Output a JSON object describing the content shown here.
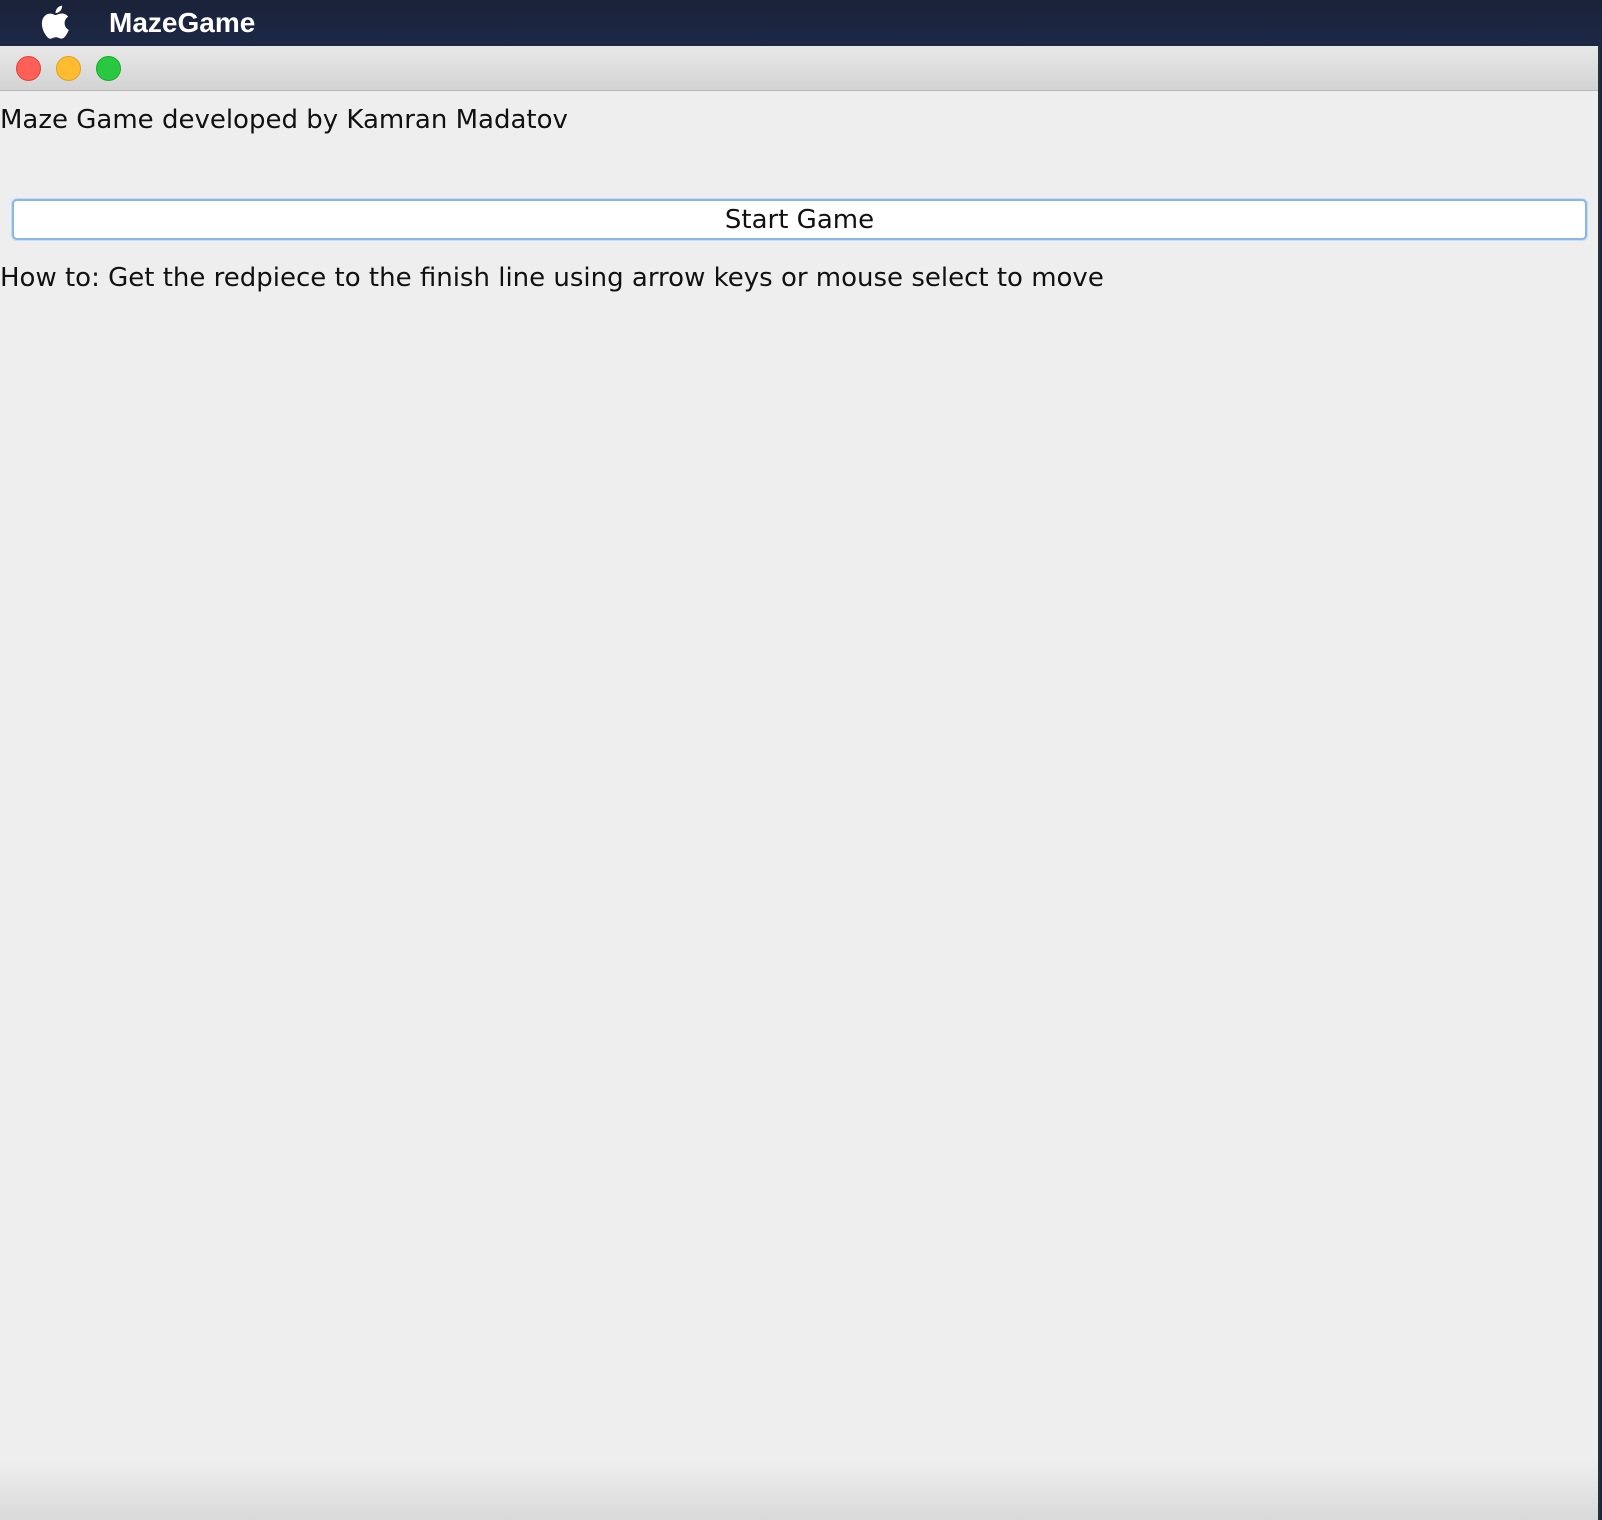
{
  "menubar": {
    "icon": "apple-icon",
    "app_name": "MazeGame"
  },
  "window": {
    "controls": [
      "close",
      "minimize",
      "zoom"
    ],
    "colors": {
      "close": "#fe5f57",
      "minimize": "#febc2e",
      "zoom": "#28c840",
      "background": "#eeeeee",
      "button_focus_ring": "#8ab6ea"
    }
  },
  "content": {
    "credit_text": "Maze Game developed by Kamran Madatov",
    "start_button_label": "Start Game",
    "howto_text": "How to: Get the redpiece to the finish line using arrow keys or mouse select to move"
  }
}
